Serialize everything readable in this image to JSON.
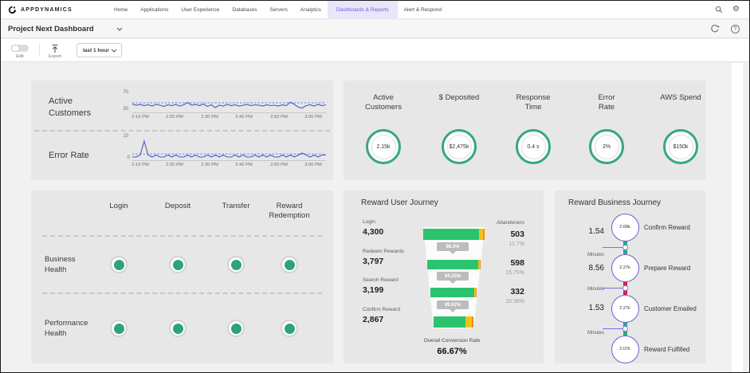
{
  "navbar": {
    "logo_text": "APPDYNAMICS",
    "items": [
      {
        "label": "Home",
        "active": false
      },
      {
        "label": "Applications",
        "active": false
      },
      {
        "label": "User Experience",
        "active": false
      },
      {
        "label": "Databases",
        "active": false
      },
      {
        "label": "Servers",
        "active": false
      },
      {
        "label": "Analytics",
        "active": false
      },
      {
        "label": "Dashboards & Reports",
        "active": true
      },
      {
        "label": "Alert & Respond",
        "active": false
      }
    ],
    "active_color": "#6a5cd5",
    "active_bg": "#eae5fa"
  },
  "dashboard_bar": {
    "title": "Project Next Dashboard"
  },
  "toolbar": {
    "edit_label": "Edit",
    "export_label": "Export",
    "time_range": "last 1 hour"
  },
  "panels": {
    "health_matrix": {
      "columns": [
        "Login",
        "Deposit",
        "Transfer",
        "Reward Redemption"
      ],
      "rows": [
        {
          "label": "Business Health",
          "statuses": [
            "normal",
            "normal",
            "normal",
            "normal"
          ]
        },
        {
          "label": "Performance Health",
          "statuses": [
            "normal",
            "normal",
            "normal",
            "normal"
          ]
        }
      ],
      "status_color": "#2da37c"
    }
  },
  "chart_data": [
    {
      "id": "active_customers_sparkline",
      "type": "line",
      "label": "Active Customers",
      "ylim": [
        30,
        70
      ],
      "ytick_top": "70",
      "ytick_bottom": "30",
      "baseline": 51,
      "line_color": "#5a50c8",
      "baseline_color": "#74a4e6",
      "x_ticks": [
        "2:10 PM",
        "2:20 PM",
        "2:30 PM",
        "2:40 PM",
        "2:50 PM",
        "3:00 PM"
      ],
      "values": [
        48,
        45,
        47,
        44,
        46,
        43,
        47,
        45,
        42,
        46,
        44,
        47,
        43,
        46,
        52,
        45,
        47,
        44,
        48,
        42,
        46,
        39,
        45,
        43,
        47,
        44,
        46,
        43,
        45,
        47,
        44,
        46,
        45,
        43,
        46,
        44,
        45,
        43,
        46,
        44,
        53,
        47,
        40,
        38,
        44,
        46,
        43,
        47,
        44,
        46
      ]
    },
    {
      "id": "error_rate_sparkline",
      "type": "line",
      "label": "Error Rate",
      "ylim": [
        0,
        10
      ],
      "ytick_top": "10",
      "ytick_bottom": "0",
      "baseline": 2.5,
      "line_color": "#5a50c8",
      "baseline_color": "#74a4e6",
      "x_ticks": [
        "2:10 PM",
        "2:20 PM",
        "2:30 PM",
        "2:40 PM",
        "2:50 PM",
        "3:00 PM"
      ],
      "values": [
        1,
        1,
        2,
        9,
        2,
        1,
        2,
        1,
        1,
        2,
        1,
        2,
        1,
        1,
        2,
        1,
        2,
        1,
        1,
        2,
        1,
        2,
        1,
        2,
        1,
        1,
        2,
        1,
        2,
        1,
        1,
        2,
        1,
        2,
        1,
        2,
        1,
        1,
        2,
        1,
        2,
        1,
        2,
        3,
        2,
        1,
        2,
        1,
        2,
        2
      ]
    },
    {
      "id": "kpi_circles",
      "type": "gauge",
      "ring_color": "#35a87c",
      "items": [
        {
          "label": "Active Customers",
          "value": "2.15k"
        },
        {
          "label": "$ Deposited",
          "value": "$2,475k"
        },
        {
          "label": "Response Time",
          "value": "0.4 s"
        },
        {
          "label": "Error Rate",
          "value": "2%"
        },
        {
          "label": "AWS Spend",
          "value": "$150k"
        }
      ]
    },
    {
      "id": "reward_user_journey",
      "type": "funnel",
      "title": "Reward User Journey",
      "abandoners_header": "Abandoners",
      "bar_colors": {
        "green": "#2bc46e",
        "yellow": "#f2c218",
        "orange": "#ef8e13"
      },
      "stages": [
        {
          "label": "Login",
          "value": 4300,
          "value_display": "4,300",
          "abandoners": "503",
          "abandon_pct": "11.7%",
          "conversion_to_next": "88.3%",
          "segments": {
            "green": 0.915,
            "yellow": 0.06,
            "orange": 0.025
          }
        },
        {
          "label": "Redeem Rewards",
          "value": 3797,
          "value_display": "3,797",
          "abandoners": "598",
          "abandon_pct": "15.75%",
          "conversion_to_next": "84.25%",
          "segments": {
            "green": 0.95,
            "yellow": 0.038,
            "orange": 0.012
          }
        },
        {
          "label": "Search Reward",
          "value": 3199,
          "value_display": "3,199",
          "abandoners": "332",
          "abandon_pct": "10.38%",
          "conversion_to_next": "89.62%",
          "segments": {
            "green": 0.945,
            "yellow": 0.042,
            "orange": 0.013
          }
        },
        {
          "label": "Confirm Reward",
          "value": 2867,
          "value_display": "2,867",
          "segments": {
            "green": 0.8,
            "yellow": 0.155,
            "orange": 0.045
          }
        }
      ],
      "footer_label": "Overall Conversion Rate",
      "footer_value": "66.67%"
    },
    {
      "id": "reward_business_journey",
      "type": "flow",
      "title": "Reward Business Journey",
      "accent_color": "#6c5fd6",
      "steps": [
        {
          "value": "2.68k",
          "label": "Confirm Reward"
        },
        {
          "value": "2.27k",
          "label": "Prepare Reward"
        },
        {
          "value": "2.27k",
          "label": "Customer Emailed"
        },
        {
          "value": "2.07k",
          "label": "Reward Fulfilled"
        }
      ],
      "transitions": [
        {
          "time": "1.54",
          "unit": "Minutes",
          "color": "#2fa880"
        },
        {
          "time": "8.56",
          "unit": "Minutes",
          "color": "#d1264a"
        },
        {
          "time": "1.53",
          "unit": "Minutes",
          "color": "#2fa880"
        }
      ]
    }
  ]
}
